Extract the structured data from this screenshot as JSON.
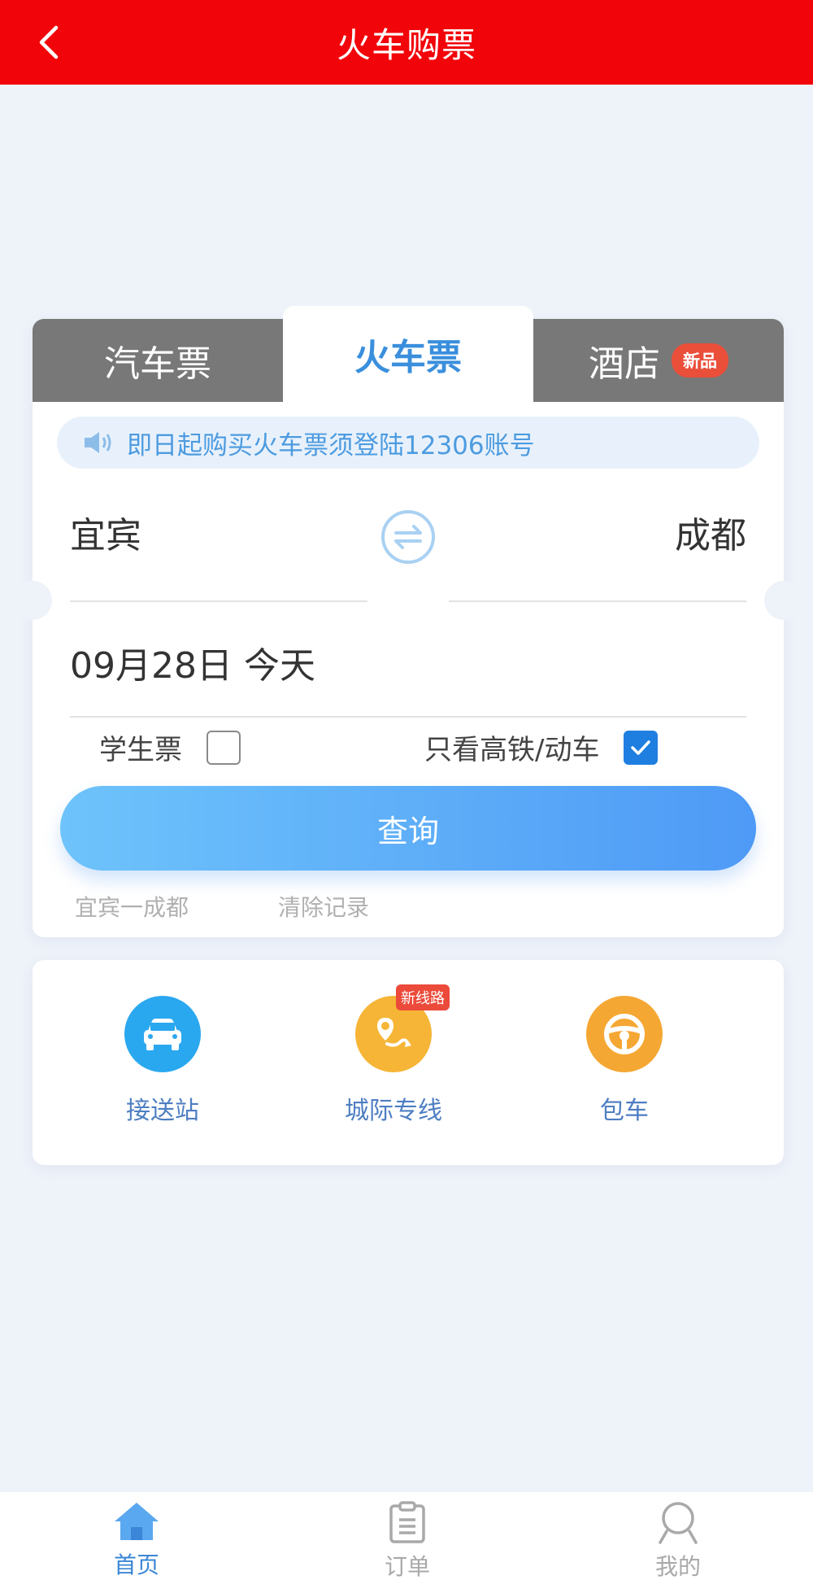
{
  "header": {
    "title": "火车购票",
    "back_icon": "back-arrow-icon"
  },
  "tabs": [
    {
      "label": "汽车票"
    },
    {
      "label": "火车票",
      "active": true
    },
    {
      "label": "酒店",
      "badge": "新品"
    }
  ],
  "notice": {
    "text": "即日起购买火车票须登陆12306账号",
    "icon": "speaker-icon"
  },
  "route": {
    "from": "宜宾",
    "to": "成都",
    "swap_icon": "swap-icon"
  },
  "date": {
    "text": "09月28日 今天"
  },
  "options": {
    "student": {
      "label": "学生票",
      "checked": false
    },
    "highspeed": {
      "label": "只看高铁/动车",
      "checked": true
    }
  },
  "query_button": "查询",
  "history": {
    "recent": "宜宾一成都",
    "clear": "清除记录"
  },
  "services": [
    {
      "label": "接送站",
      "icon": "car-icon",
      "color": "#2aa8ef"
    },
    {
      "label": "城际专线",
      "icon": "route-pin-icon",
      "color": "#f6b536",
      "tag": "新线路"
    },
    {
      "label": "包车",
      "icon": "steering-wheel-icon",
      "color": "#f5a733"
    }
  ],
  "nav": [
    {
      "label": "首页",
      "icon": "home-icon",
      "active": true
    },
    {
      "label": "订单",
      "icon": "clipboard-icon"
    },
    {
      "label": "我的",
      "icon": "user-icon"
    }
  ],
  "colors": {
    "header_bg": "#f2050a",
    "accent": "#3a8fdd",
    "query_gradient_start": "#6ec3fb",
    "query_gradient_end": "#4e9af6",
    "badge": "#ea4f3a"
  }
}
